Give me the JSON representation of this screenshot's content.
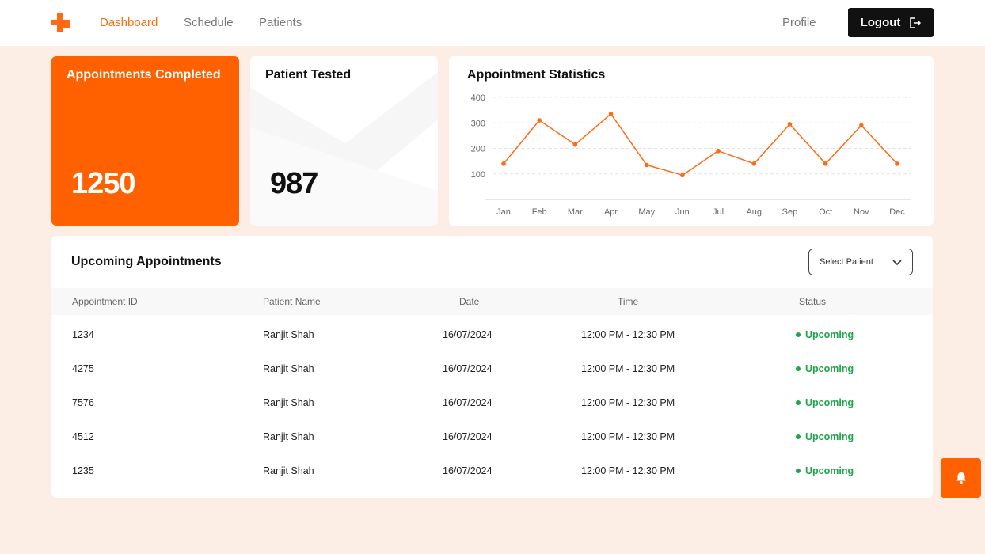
{
  "nav": {
    "items": [
      {
        "label": "Dashboard",
        "active": true
      },
      {
        "label": "Schedule",
        "active": false
      },
      {
        "label": "Patients",
        "active": false
      }
    ],
    "profile_label": "Profile",
    "logout_label": "Logout"
  },
  "colors": {
    "accent": "#ff6100",
    "status_upcoming": "#1ea54a",
    "page_bg": "#fdeee5"
  },
  "stats": {
    "completed": {
      "title": "Appointments Completed",
      "value": "1250"
    },
    "tested": {
      "title": "Patient Tested",
      "value": "987"
    }
  },
  "chart_data": {
    "type": "line",
    "title": "Appointment Statistics",
    "categories": [
      "Jan",
      "Feb",
      "Mar",
      "Apr",
      "May",
      "Jun",
      "Jul",
      "Aug",
      "Sep",
      "Oct",
      "Nov",
      "Dec"
    ],
    "values": [
      140,
      310,
      215,
      335,
      135,
      95,
      190,
      140,
      295,
      140,
      290,
      140
    ],
    "yticks": [
      100,
      200,
      300,
      400
    ],
    "ylim": [
      0,
      400
    ],
    "grid": true,
    "color": "#ff6a13"
  },
  "appointments": {
    "title": "Upcoming Appointments",
    "select_placeholder": "Select Patient",
    "columns": [
      "Appointment ID",
      "Patient Name",
      "Date",
      "Time",
      "Status"
    ],
    "rows": [
      {
        "id": "1234",
        "name": "Ranjit Shah",
        "date": "16/07/2024",
        "time": "12:00 PM - 12:30 PM",
        "status": "Upcoming"
      },
      {
        "id": "4275",
        "name": "Ranjit Shah",
        "date": "16/07/2024",
        "time": "12:00 PM - 12:30 PM",
        "status": "Upcoming"
      },
      {
        "id": "7576",
        "name": "Ranjit Shah",
        "date": "16/07/2024",
        "time": "12:00 PM - 12:30 PM",
        "status": "Upcoming"
      },
      {
        "id": "4512",
        "name": "Ranjit Shah",
        "date": "16/07/2024",
        "time": "12:00 PM - 12:30 PM",
        "status": "Upcoming"
      },
      {
        "id": "1235",
        "name": "Ranjit Shah",
        "date": "16/07/2024",
        "time": "12:00 PM - 12:30 PM",
        "status": "Upcoming"
      }
    ]
  },
  "icons": {
    "logo": "cross-logo-icon",
    "logout": "logout-icon",
    "chevron": "chevron-down-icon",
    "bell": "bell-icon"
  }
}
